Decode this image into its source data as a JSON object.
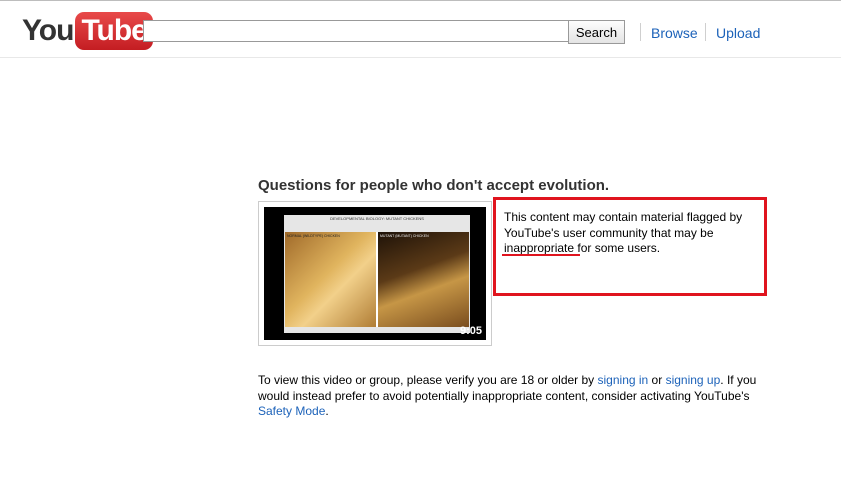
{
  "header": {
    "logo": {
      "you": "You",
      "tube": "Tube"
    },
    "search": {
      "value": "",
      "placeholder": "",
      "button_label": "Search"
    },
    "nav": {
      "browse": "Browse",
      "upload": "Upload"
    }
  },
  "video": {
    "title": "Questions for people who don't accept evolution.",
    "duration": "9:05",
    "thumbnail": {
      "slide_title": "DEVELOPMENTAL BIOLOGY: MUTANT CHICKENS",
      "left_label": "NORMAL (WILDTYPE) CHICKEN",
      "right_label": "MUTANT (MUTANT) CHICKEN"
    }
  },
  "warning": {
    "text_before": "This content may contain material flagged by YouTube's user community that may be ",
    "text_highlight": "inappropriate",
    "text_after": " for some users."
  },
  "age_gate": {
    "part1": "To view this video or group, please verify you are 18 or older by ",
    "link_sign_in": "signing in",
    "part2": " or ",
    "link_sign_up": "signing up",
    "part3": ". If you would instead prefer to avoid potentially inappropriate content, consider activating YouTube's ",
    "link_safety_mode": "Safety Mode",
    "part4": "."
  },
  "colors": {
    "brand_red": "#d6262a",
    "link_blue": "#1c62b9",
    "highlight_red": "#e0141e"
  }
}
